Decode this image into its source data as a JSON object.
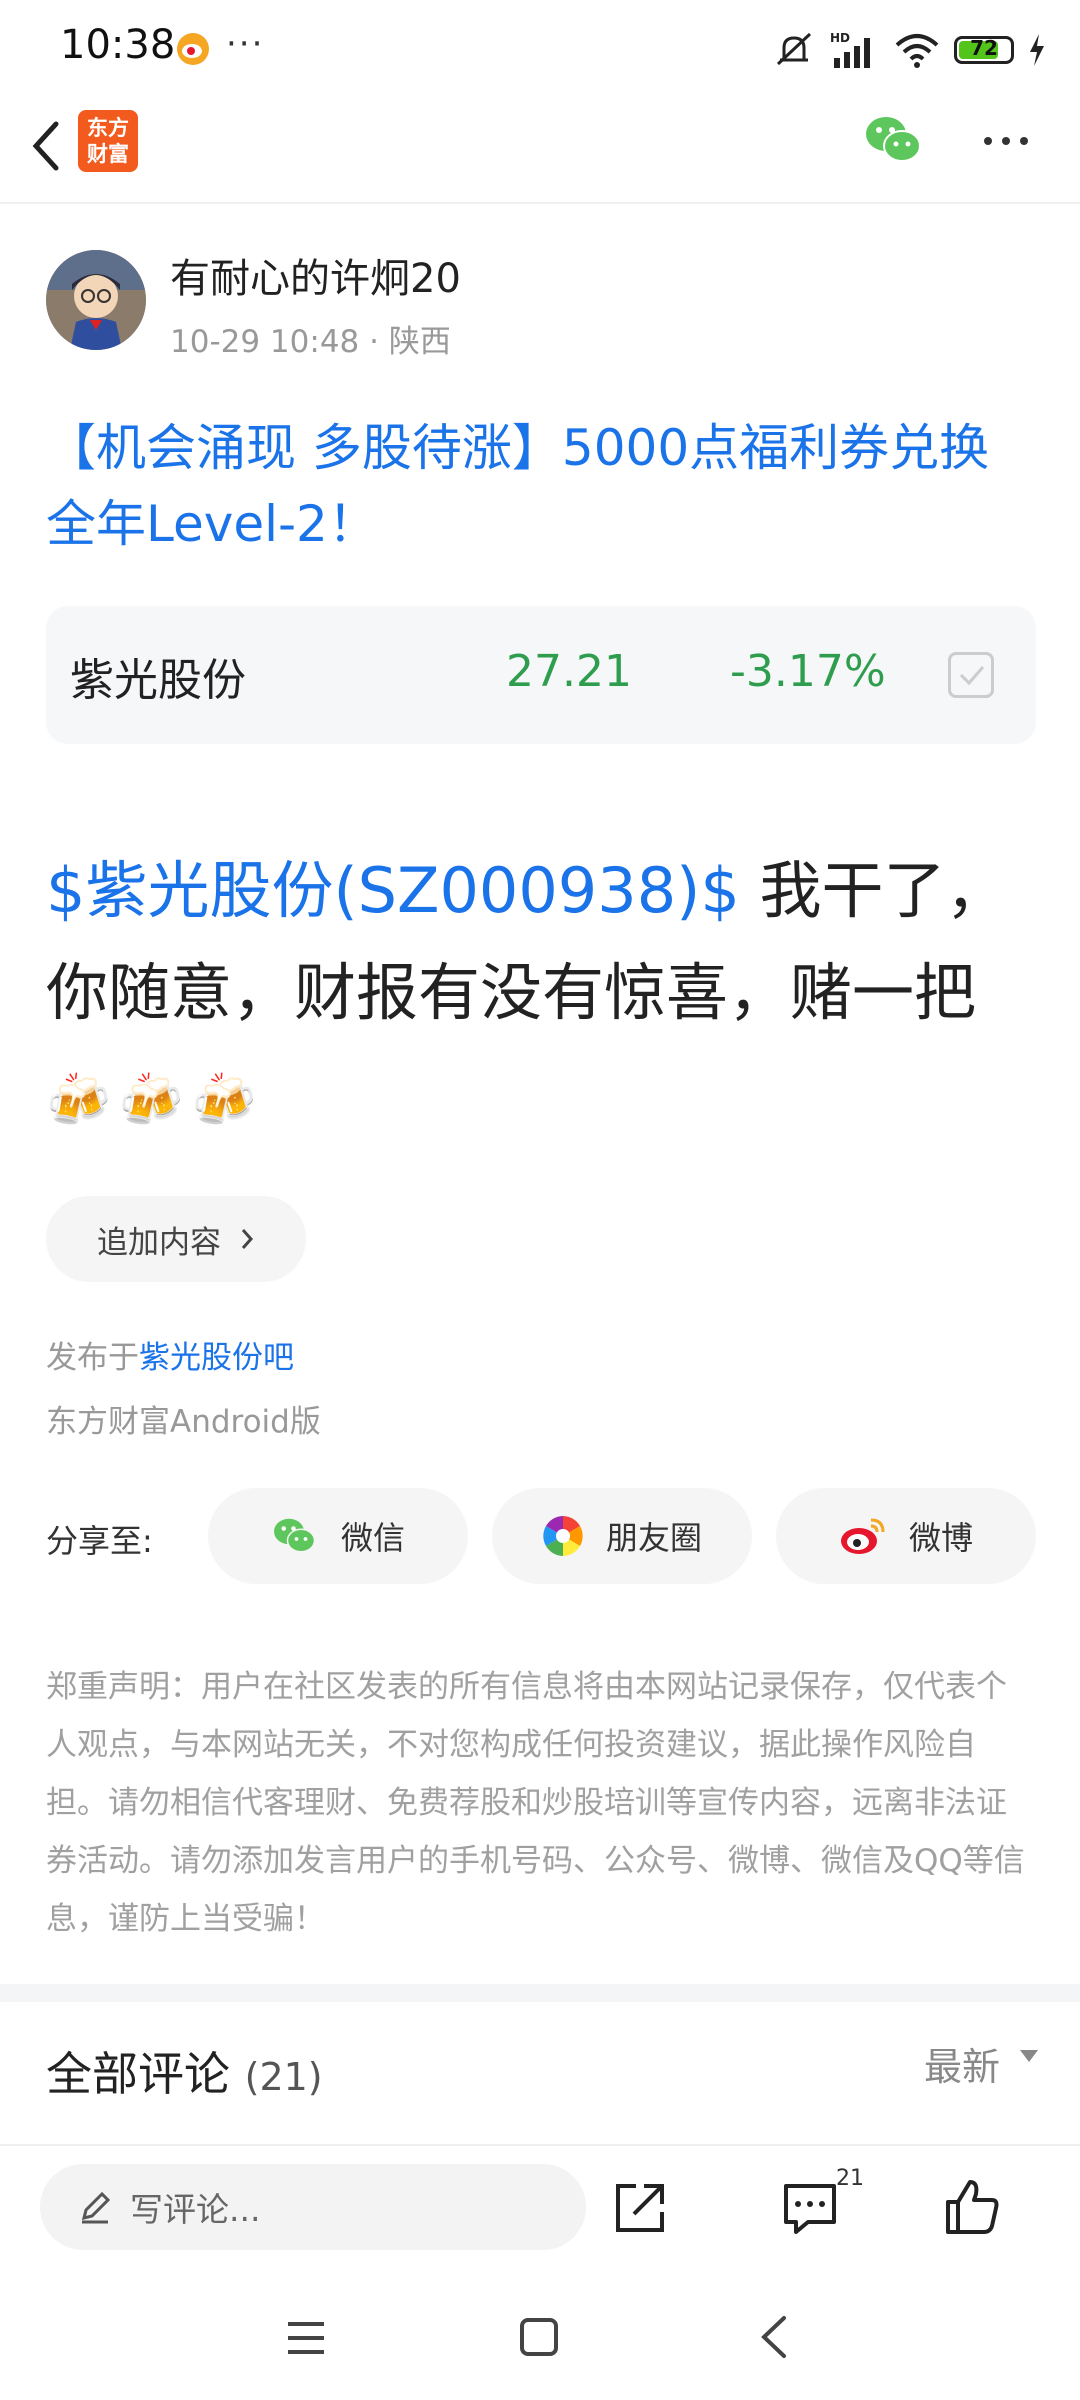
{
  "status_bar": {
    "time": "10:38",
    "dots": "···",
    "battery": "72",
    "icons": [
      "weibo-icon",
      "mute-icon",
      "hd-signal-icon",
      "wifi-icon",
      "battery-icon",
      "charging-icon"
    ]
  },
  "nav": {
    "logo_line1": "东方",
    "logo_line2": "财富",
    "icons": [
      "back-icon",
      "wechat-icon",
      "more-icon"
    ]
  },
  "author": {
    "name": "有耐心的许炯20",
    "meta": "10-29 10:48 · 陕西"
  },
  "post": {
    "title": "【机会涌现 多股待涨】5000点福利券兑换全年Level-2！",
    "stock": {
      "name": "紫光股份",
      "price": "27.21",
      "change": "-3.17%"
    },
    "tag": "$紫光股份(SZ000938)$",
    "body": "我干了，你随意，财报有没有惊喜，赌一把",
    "emojis": "🍻🍻🍻",
    "append_label": "追加内容",
    "published_prefix": "发布于",
    "published_bar": "紫光股份吧",
    "client": "东方财富Android版"
  },
  "share": {
    "label": "分享至:",
    "wechat": "微信",
    "moments": "朋友圈",
    "weibo": "微博"
  },
  "disclaimer": "郑重声明：用户在社区发表的所有信息将由本网站记录保存，仅代表个人观点，与本网站无关，不对您构成任何投资建议，据此操作风险自担。请勿相信代客理财、免费荐股和炒股培训等宣传内容，远离非法证券活动。请勿添加发言用户的手机号码、公众号、微博、微信及QQ等信息，谨防上当受骗！",
  "comments": {
    "title": "全部评论",
    "count": "(21)",
    "sort": "最新"
  },
  "bottom_bar": {
    "placeholder": "写评论...",
    "comment_badge": "21"
  },
  "colors": {
    "link": "#1a73e8",
    "price_down": "#2e9e4e",
    "brand": "#f25a1e"
  }
}
